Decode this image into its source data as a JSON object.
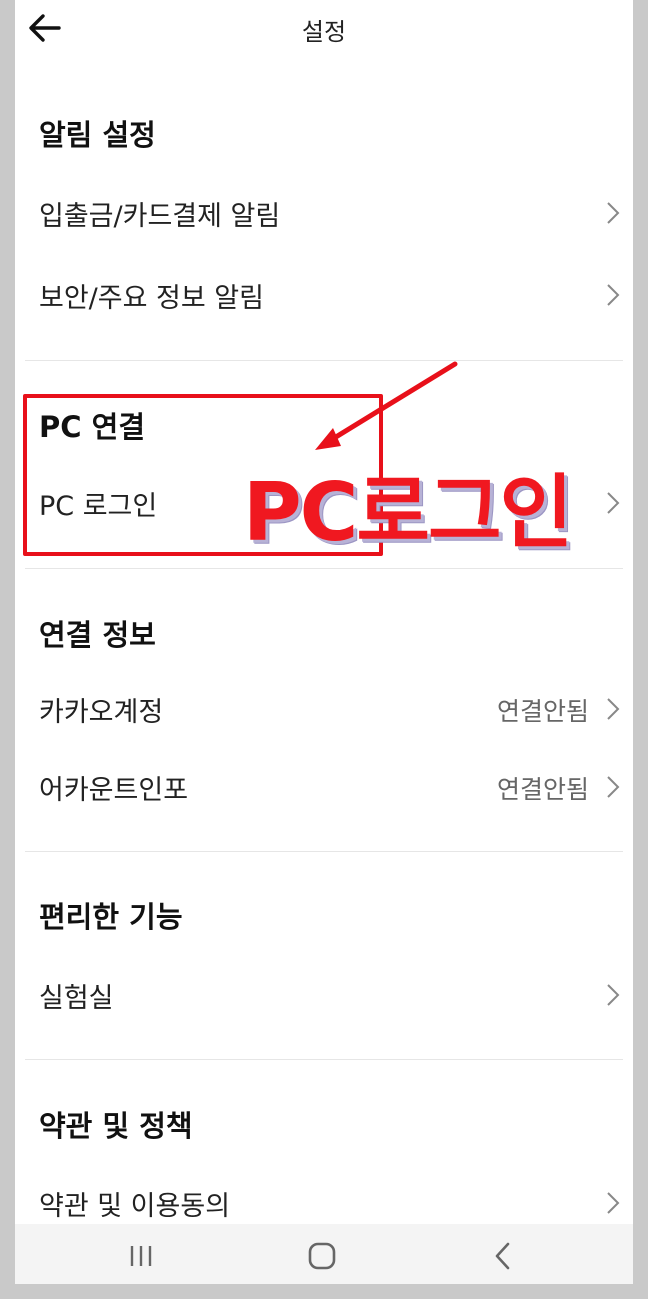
{
  "header": {
    "title": "설정"
  },
  "sections": {
    "notifications": {
      "title": "알림 설정",
      "items": [
        "입출금/카드결제 알림",
        "보안/주요 정보 알림"
      ]
    },
    "pc": {
      "title": "PC 연결",
      "items": [
        "PC 로그인"
      ]
    },
    "connection": {
      "title": "연결 정보",
      "items": [
        {
          "label": "카카오계정",
          "value": "연결안됨"
        },
        {
          "label": "어카운트인포",
          "value": "연결안됨"
        }
      ]
    },
    "convenience": {
      "title": "편리한 기능",
      "items": [
        "실험실"
      ]
    },
    "terms": {
      "title": "약관 및 정책",
      "items": [
        "약관 및 이용동의"
      ]
    }
  },
  "annotation": {
    "text": "PC로그인",
    "color": "#f01820"
  },
  "icons": {
    "back": "back-arrow-icon",
    "chevron": "chevron-right-icon",
    "nav_recent": "recent-apps-icon",
    "nav_home": "home-icon",
    "nav_back": "nav-back-icon"
  }
}
